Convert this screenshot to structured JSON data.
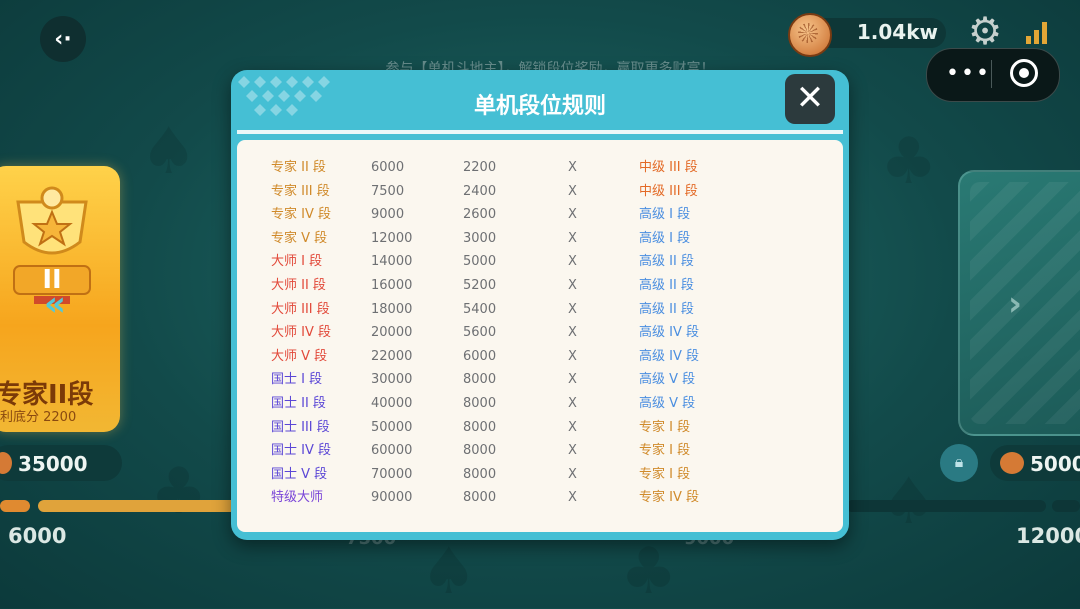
{
  "colors": {
    "expert": "#d08a2a",
    "master": "#e2493a",
    "guoshi": "#5b47d6",
    "super_master": "#7a45d8",
    "intermediate": "#e36a26",
    "advanced": "#4a8ee0"
  },
  "topbar": {
    "back_icon": "back-arrow-icon",
    "coins": "1.04kw",
    "settings_icon": "gear-icon",
    "signal_icon": "signal-icon",
    "more_icon": "more-dots-icon",
    "target_icon": "target-icon",
    "subtitle": "参与【单机斗地主】，解锁段位奖励，赢取更多财富！"
  },
  "left_card": {
    "rank": "专家II段",
    "base_score": "利底分 2200",
    "amount": "35000",
    "progress_value": "6000"
  },
  "right_card": {
    "amount": "5000",
    "progress_value": "12000",
    "lock_icon": "lock-icon"
  },
  "progress_mid": [
    "7500",
    "9000"
  ],
  "modal": {
    "title": "单机段位规则",
    "close_icon": "close-icon",
    "rows": [
      {
        "rank": "专家 II 段",
        "score": "6000",
        "base": "2200",
        "x": "X",
        "down": "中级 III 段",
        "rc": "expert",
        "dc": "intermediate"
      },
      {
        "rank": "专家 III 段",
        "score": "7500",
        "base": "2400",
        "x": "X",
        "down": "中级 III 段",
        "rc": "expert",
        "dc": "intermediate"
      },
      {
        "rank": "专家 IV 段",
        "score": "9000",
        "base": "2600",
        "x": "X",
        "down": "高级 I 段",
        "rc": "expert",
        "dc": "advanced"
      },
      {
        "rank": "专家 V 段",
        "score": "12000",
        "base": "3000",
        "x": "X",
        "down": "高级 I 段",
        "rc": "expert",
        "dc": "advanced"
      },
      {
        "rank": "大师 I 段",
        "score": "14000",
        "base": "5000",
        "x": "X",
        "down": "高级 II 段",
        "rc": "master",
        "dc": "advanced"
      },
      {
        "rank": "大师 II 段",
        "score": "16000",
        "base": "5200",
        "x": "X",
        "down": "高级 II 段",
        "rc": "master",
        "dc": "advanced"
      },
      {
        "rank": "大师 III 段",
        "score": "18000",
        "base": "5400",
        "x": "X",
        "down": "高级 II 段",
        "rc": "master",
        "dc": "advanced"
      },
      {
        "rank": "大师 IV 段",
        "score": "20000",
        "base": "5600",
        "x": "X",
        "down": "高级 IV 段",
        "rc": "master",
        "dc": "advanced"
      },
      {
        "rank": "大师 V 段",
        "score": "22000",
        "base": "6000",
        "x": "X",
        "down": "高级 IV 段",
        "rc": "master",
        "dc": "advanced"
      },
      {
        "rank": "国士 I 段",
        "score": "30000",
        "base": "8000",
        "x": "X",
        "down": "高级 V 段",
        "rc": "guoshi",
        "dc": "advanced"
      },
      {
        "rank": "国士 II 段",
        "score": "40000",
        "base": "8000",
        "x": "X",
        "down": "高级 V 段",
        "rc": "guoshi",
        "dc": "advanced"
      },
      {
        "rank": "国士 III 段",
        "score": "50000",
        "base": "8000",
        "x": "X",
        "down": "专家 I 段",
        "rc": "guoshi",
        "dc": "expert"
      },
      {
        "rank": "国士 IV 段",
        "score": "60000",
        "base": "8000",
        "x": "X",
        "down": "专家 I 段",
        "rc": "guoshi",
        "dc": "expert"
      },
      {
        "rank": "国士 V 段",
        "score": "70000",
        "base": "8000",
        "x": "X",
        "down": "专家 I 段",
        "rc": "guoshi",
        "dc": "expert"
      },
      {
        "rank": "特级大师",
        "score": "90000",
        "base": "8000",
        "x": "X",
        "down": "专家 IV 段",
        "rc": "super_master",
        "dc": "expert"
      }
    ]
  }
}
